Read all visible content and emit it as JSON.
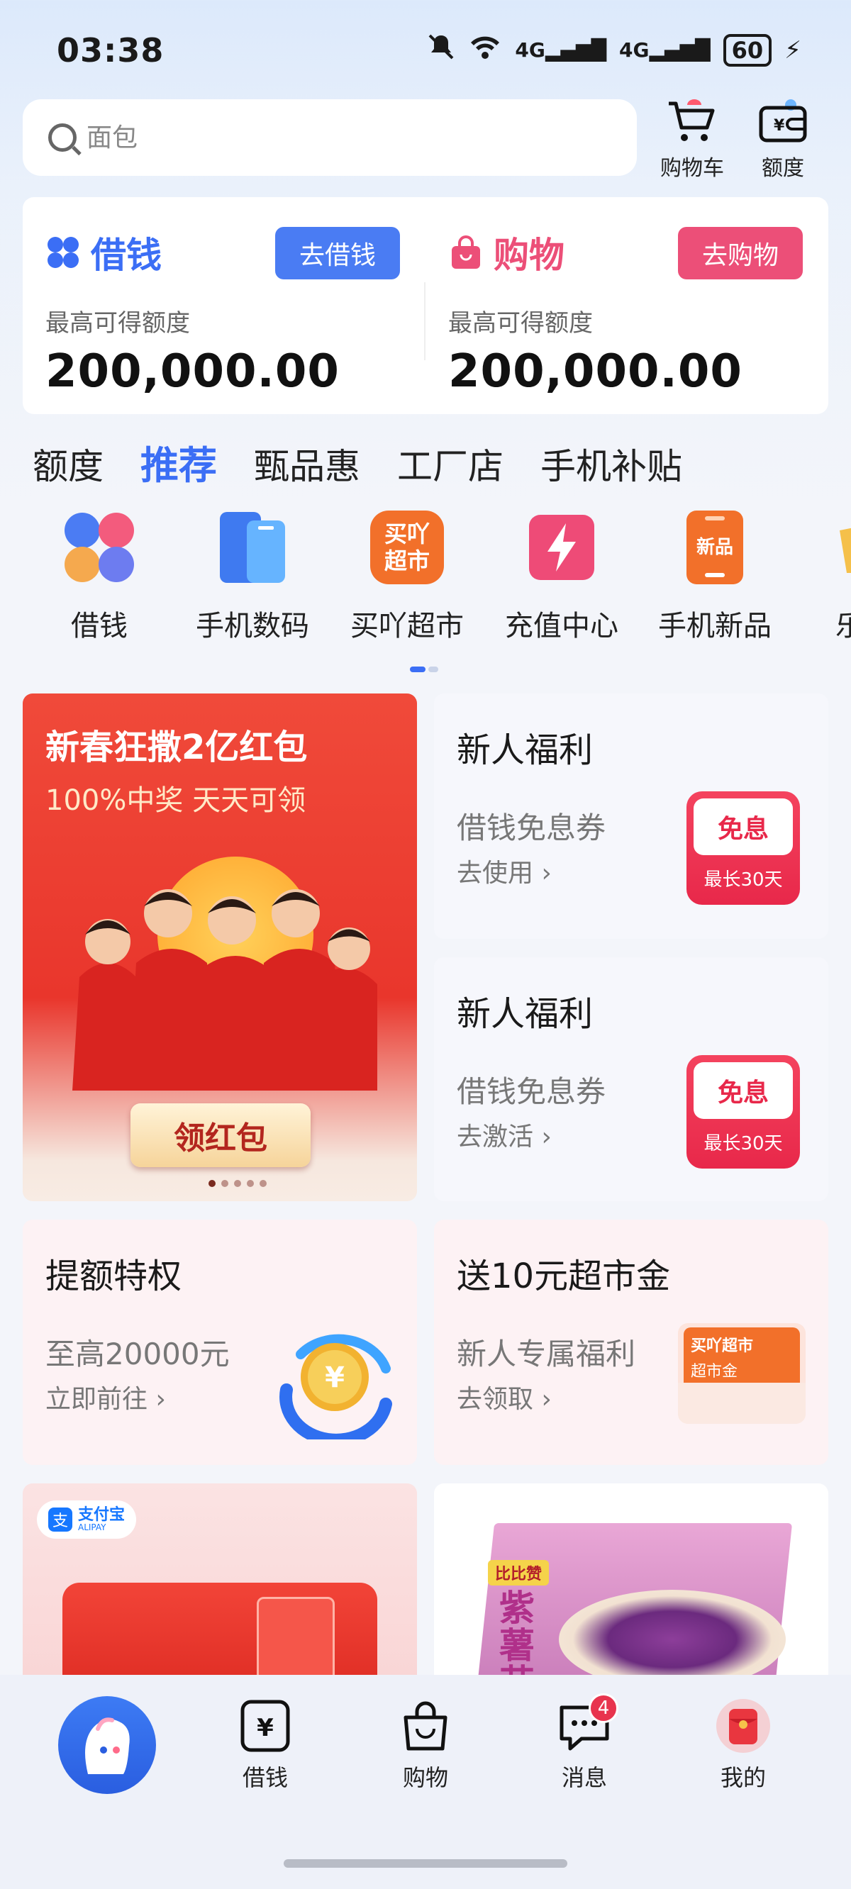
{
  "status_bar": {
    "time": "03:38",
    "battery": "60",
    "signal_1": "4G",
    "signal_2": "4G"
  },
  "search": {
    "placeholder": "面包"
  },
  "header_actions": {
    "cart_label": "购物车",
    "quota_label": "额度"
  },
  "credit": {
    "borrow": {
      "title": "借钱",
      "button": "去借钱",
      "subtitle": "最高可得额度",
      "amount": "200,000.00"
    },
    "shop": {
      "title": "购物",
      "button": "去购物",
      "subtitle": "最高可得额度",
      "amount": "200,000.00"
    }
  },
  "tabs": [
    {
      "label": "额度",
      "active": false
    },
    {
      "label": "推荐",
      "active": true
    },
    {
      "label": "甄品惠",
      "active": false
    },
    {
      "label": "工厂店",
      "active": false
    },
    {
      "label": "手机补贴",
      "active": false
    }
  ],
  "categories": [
    {
      "label": "借钱",
      "icon": "clover-icon"
    },
    {
      "label": "手机数码",
      "icon": "phones-icon"
    },
    {
      "label": "买吖超市",
      "icon": "supermarket-icon",
      "icon_text": "买吖超市"
    },
    {
      "label": "充值中心",
      "icon": "lightning-icon"
    },
    {
      "label": "手机新品",
      "icon": "new-phone-icon",
      "icon_text": "新品"
    },
    {
      "label": "乐享",
      "icon": "partial-icon"
    }
  ],
  "banner": {
    "title": "新春狂撒2亿红包",
    "subtitle": "100%中奖 天天可领",
    "button": "领红包"
  },
  "welfare_cards": [
    {
      "title": "新人福利",
      "subtitle": "借钱免息券",
      "action": "去使用",
      "coupon_main": "免息",
      "coupon_sub": "最长30天"
    },
    {
      "title": "新人福利",
      "subtitle": "借钱免息券",
      "action": "去激活",
      "coupon_main": "免息",
      "coupon_sub": "最长30天"
    }
  ],
  "feature_cards": [
    {
      "title": "提额特权",
      "subtitle": "至高20000元",
      "action": "立即前往",
      "icon": "coin-refresh-icon"
    },
    {
      "title": "送10元超市金",
      "subtitle": "新人专属福利",
      "action": "去领取",
      "icon": "supermarket-envelope-icon",
      "icon_text_1": "买吖超市",
      "icon_text_2": "超市金"
    }
  ],
  "bottom_cards": [
    {
      "badge": "支付宝",
      "badge_en": "ALIPAY"
    },
    {
      "brand": "比比赞",
      "product": "紫薯芋泥"
    }
  ],
  "tabbar": [
    {
      "label": "",
      "icon": "mascot-icon"
    },
    {
      "label": "借钱",
      "icon": "yuan-icon"
    },
    {
      "label": "购物",
      "icon": "bag-icon"
    },
    {
      "label": "消息",
      "icon": "chat-icon",
      "badge": "4"
    },
    {
      "label": "我的",
      "icon": "red-envelope-icon"
    }
  ],
  "colors": {
    "accent_blue": "#3b6ef5",
    "accent_pink": "#ec4f78",
    "tab_active": "#3b6ef5"
  }
}
